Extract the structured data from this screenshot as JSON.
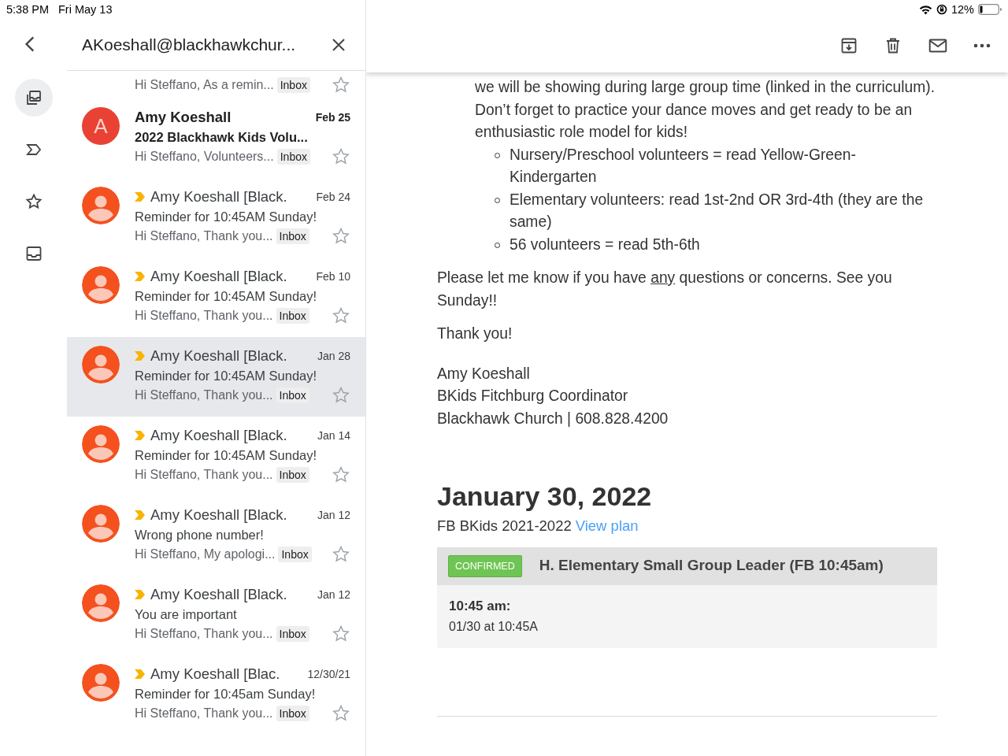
{
  "status_bar": {
    "time": "5:38 PM",
    "date": "Fri May 13",
    "battery": "12%"
  },
  "thread_header": {
    "title": "AKoeshall@blackhawkchur..."
  },
  "rail": [
    {
      "kind": "all-inboxes",
      "selected": true
    },
    {
      "kind": "label",
      "selected": false
    },
    {
      "kind": "star",
      "selected": false
    },
    {
      "kind": "inbox",
      "selected": false
    }
  ],
  "emails": [
    {
      "kind": "partial",
      "preview": "Hi Steffano, As a remin...",
      "label": "Inbox",
      "selected": false
    },
    {
      "kind": "letter",
      "sender": "Amy Koeshall",
      "date": "Feb 25",
      "subject": "2022 Blackhawk Kids Volu...",
      "preview": "Hi Steffano, Volunteers...",
      "label": "Inbox",
      "letter": "A",
      "important": false,
      "unread": true,
      "selected": false
    },
    {
      "kind": "person",
      "sender": "Amy Koeshall [Black.",
      "date": "Feb 24",
      "subject": "Reminder for 10:45AM Sunday!",
      "preview": "Hi Steffano, Thank you...",
      "label": "Inbox",
      "important": true,
      "unread": false,
      "selected": false
    },
    {
      "kind": "person",
      "sender": "Amy Koeshall [Black.",
      "date": "Feb 10",
      "subject": "Reminder for 10:45AM Sunday!",
      "preview": "Hi Steffano, Thank you...",
      "label": "Inbox",
      "important": true,
      "unread": false,
      "selected": false
    },
    {
      "kind": "person",
      "sender": "Amy Koeshall [Black.",
      "date": "Jan 28",
      "subject": "Reminder for 10:45AM Sunday!",
      "preview": "Hi Steffano, Thank you...",
      "label": "Inbox",
      "important": true,
      "unread": false,
      "selected": true
    },
    {
      "kind": "person",
      "sender": "Amy Koeshall [Black.",
      "date": "Jan 14",
      "subject": "Reminder for 10:45AM Sunday!",
      "preview": "Hi Steffano, Thank you...",
      "label": "Inbox",
      "important": true,
      "unread": false,
      "selected": false
    },
    {
      "kind": "person",
      "sender": "Amy Koeshall [Black.",
      "date": "Jan 12",
      "subject": "Wrong phone number!",
      "preview": "Hi Steffano, My apologi...",
      "label": "Inbox",
      "important": true,
      "unread": false,
      "selected": false
    },
    {
      "kind": "person",
      "sender": "Amy Koeshall [Black.",
      "date": "Jan 12",
      "subject": "You are important",
      "preview": "Hi Steffano, Thank you...",
      "label": "Inbox",
      "important": true,
      "unread": false,
      "selected": false
    },
    {
      "kind": "person",
      "sender": "Amy Koeshall [Blac.",
      "date": "12/30/21",
      "subject": "Reminder for 10:45am Sunday!",
      "preview": "Hi Steffano, Thank you...",
      "label": "Inbox",
      "important": true,
      "unread": false,
      "selected": false
    }
  ],
  "message": {
    "numbered_item": {
      "text": "we will be showing during large group time (linked in the curriculum). Don’t forget to practice your dance moves and get ready to be an enthusiastic role model for kids!"
    },
    "bullets": [
      "Nursery/Preschool volunteers = read Yellow-Green-Kindergarten",
      "Elementary volunteers: read 1st-2nd OR 3rd-4th (they are the same)",
      "56 volunteers = read 5th-6th"
    ],
    "closing": {
      "before": "Please let me know if you have ",
      "underlined": "any",
      "after": " questions or concerns. See you Sunday!!"
    },
    "thanks": "Thank you!",
    "signature": [
      "Amy Koeshall",
      "BKids Fitchburg Coordinator",
      "Blackhawk Church | 608.828.4200"
    ],
    "event": {
      "heading": "January 30, 2022",
      "plan": "FB BKids 2021-2022",
      "plan_link": "View plan",
      "status": "CONFIRMED",
      "role": "H. Elementary Small Group Leader (FB 10:45am)",
      "time": "10:45 am:",
      "detail": "01/30 at 10:45A"
    }
  }
}
